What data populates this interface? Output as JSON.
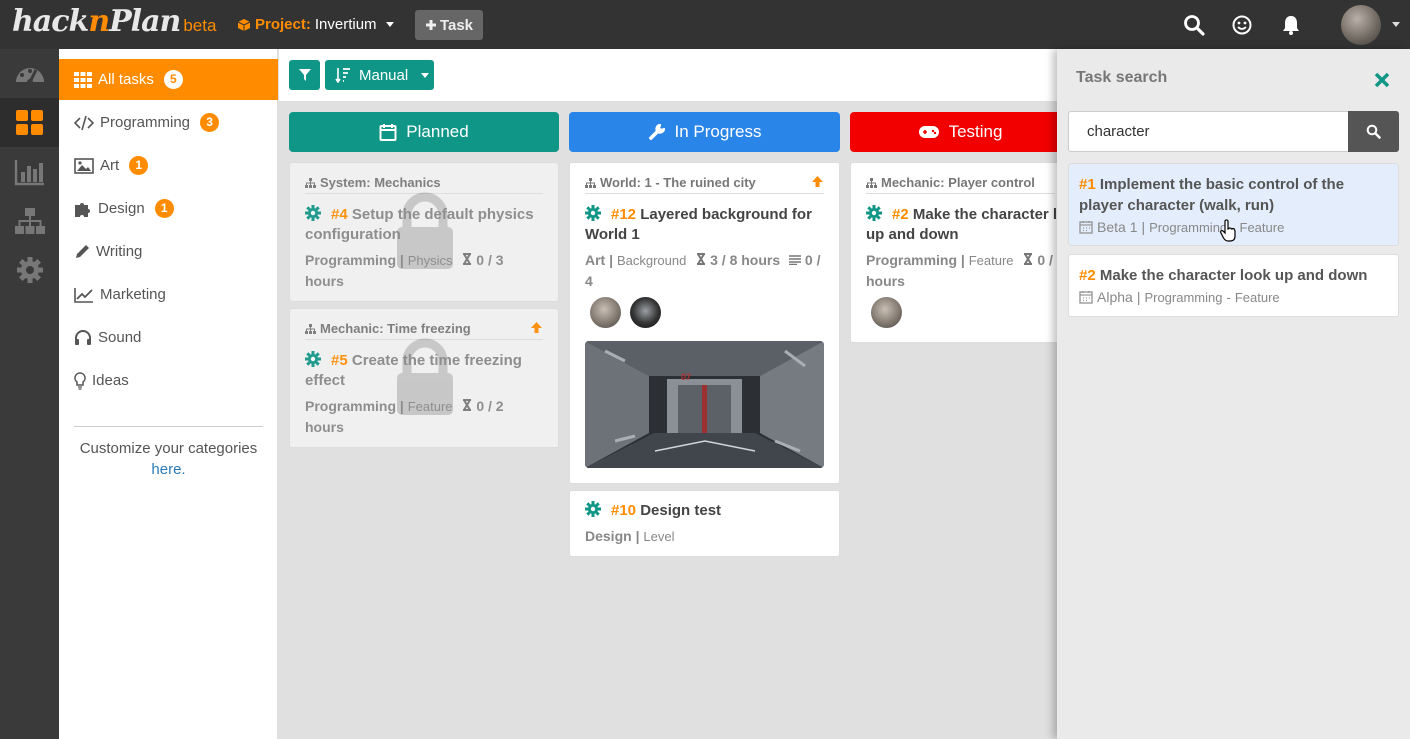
{
  "topbar": {
    "logo_hack": "hack",
    "logo_n": "n",
    "logo_plan": "Plan",
    "logo_beta": "beta",
    "project_label": "Project:",
    "project_value": "Invertium",
    "task_button": "Task",
    "icons": [
      "search-icon",
      "smiley-icon",
      "bell-icon",
      "avatar"
    ]
  },
  "leftnav": {
    "icons": [
      "dashboard-icon",
      "board-icon",
      "chart-icon",
      "hierarchy-icon",
      "gear-icon"
    ],
    "active": "board-icon"
  },
  "categories": {
    "items": [
      {
        "label": "All tasks",
        "count": "5",
        "icon": "grid-icon"
      },
      {
        "label": "Programming",
        "count": "3",
        "icon": "code-icon"
      },
      {
        "label": "Art",
        "count": "1",
        "icon": "image-icon"
      },
      {
        "label": "Design",
        "count": "1",
        "icon": "puzzle-icon"
      },
      {
        "label": "Writing",
        "count": "",
        "icon": "pencil-icon"
      },
      {
        "label": "Marketing",
        "count": "",
        "icon": "line-chart-icon"
      },
      {
        "label": "Sound",
        "count": "",
        "icon": "headphones-icon"
      },
      {
        "label": "Ideas",
        "count": "",
        "icon": "lightbulb-icon"
      }
    ],
    "customize_text": "Customize your categories",
    "customize_link": "here",
    "customize_end": "."
  },
  "toolbar": {
    "sort_label": "Manual"
  },
  "columns": [
    {
      "label": "Planned",
      "color": "#109687",
      "icon": "calendar-icon"
    },
    {
      "label": "In Progress",
      "color": "#2a85e8",
      "icon": "wrench-icon"
    },
    {
      "label": "Testing",
      "color": "#f20000",
      "icon": "gamepad-icon"
    }
  ],
  "cards": {
    "c4": {
      "group": "System: Mechanics",
      "num": "#4",
      "title": "Setup the default physics configuration",
      "category": "Programming",
      "type": "Physics",
      "hours": "0 / 3 hours"
    },
    "c5": {
      "group": "Mechanic: Time freezing",
      "num": "#5",
      "title": "Create the time freezing effect",
      "category": "Programming",
      "type": "Feature",
      "hours": "0 / 2 hours"
    },
    "c12": {
      "group": "World: 1 - The ruined city",
      "num": "#12",
      "title": "Layered background for World 1",
      "category": "Art",
      "type": "Background",
      "hours": "3 / 8 hours",
      "subtasks": "0 / 4"
    },
    "c10": {
      "num": "#10",
      "title": "Design test",
      "category": "Design",
      "type": "Level"
    },
    "c2": {
      "group": "Mechanic: Player control",
      "num": "#2",
      "title": "Make the character l up and down",
      "category": "Programming",
      "type": "Feature",
      "hours": "0 /",
      "hours2": "hours"
    }
  },
  "search": {
    "title": "Task search",
    "query": "character",
    "results": [
      {
        "num": "#1",
        "title": "Implement the basic control of the player character (walk, run)",
        "milestone": "Beta 1",
        "category": "Programming",
        "type": "Feature"
      },
      {
        "num": "#2",
        "title": "Make the character look up and down",
        "milestone": "Alpha",
        "category": "Programming",
        "type": "Feature"
      }
    ]
  }
}
